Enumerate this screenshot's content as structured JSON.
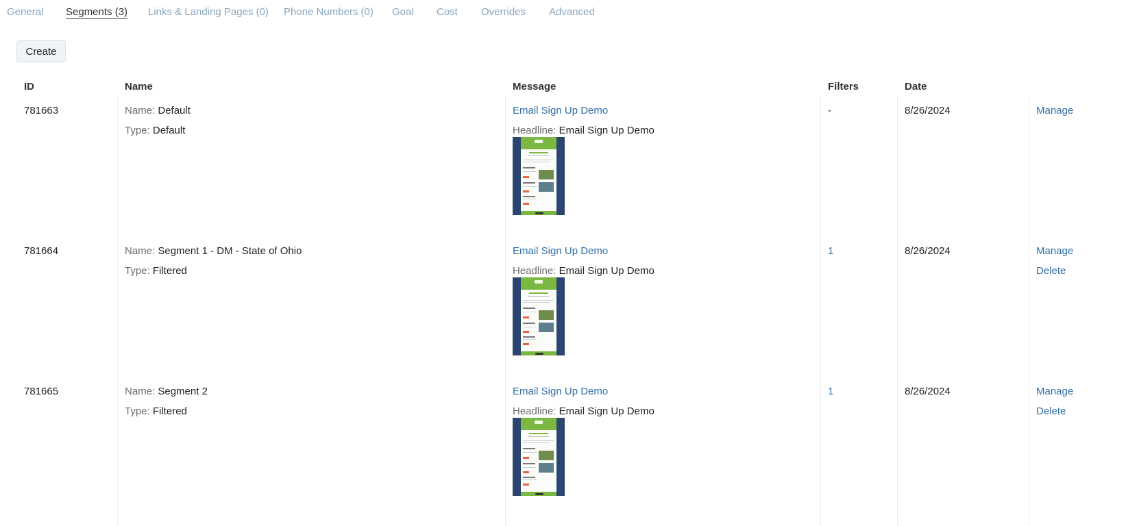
{
  "tabs": [
    {
      "label": "General",
      "active": false
    },
    {
      "label": "Segments (3)",
      "active": true
    },
    {
      "label": "Links & Landing Pages (0)",
      "active": false
    },
    {
      "label": "Phone Numbers (0)",
      "active": false
    },
    {
      "label": "Goal",
      "active": false
    },
    {
      "label": "Cost",
      "active": false
    },
    {
      "label": "Overrides",
      "active": false
    },
    {
      "label": "Advanced",
      "active": false
    }
  ],
  "create_label": "Create",
  "table": {
    "headers": {
      "id": "ID",
      "name": "Name",
      "message": "Message",
      "filters": "Filters",
      "date": "Date"
    },
    "name_label": "Name:",
    "type_label": "Type:",
    "headline_label": "Headline:",
    "rows": [
      {
        "id": "781663",
        "name": "Default",
        "type": "Default",
        "message": "Email Sign Up Demo",
        "headline": "Email Sign Up Demo",
        "filters": "-",
        "date": "8/26/2024",
        "manage": "Manage",
        "delete": ""
      },
      {
        "id": "781664",
        "name": "Segment 1 - DM - State of Ohio",
        "type": "Filtered",
        "message": "Email Sign Up Demo",
        "headline": "Email Sign Up Demo",
        "filters": "1",
        "date": "8/26/2024",
        "manage": "Manage",
        "delete": "Delete"
      },
      {
        "id": "781665",
        "name": "Segment 2",
        "type": "Filtered",
        "message": "Email Sign Up Demo",
        "headline": "Email Sign Up Demo",
        "filters": "1",
        "date": "8/26/2024",
        "manage": "Manage",
        "delete": "Delete"
      }
    ]
  },
  "colors": {
    "link": "#2f6ea8",
    "tab_inactive": "#8aa6bd",
    "thumb_frame": "#2b4670",
    "thumb_accent": "#7bb842"
  }
}
